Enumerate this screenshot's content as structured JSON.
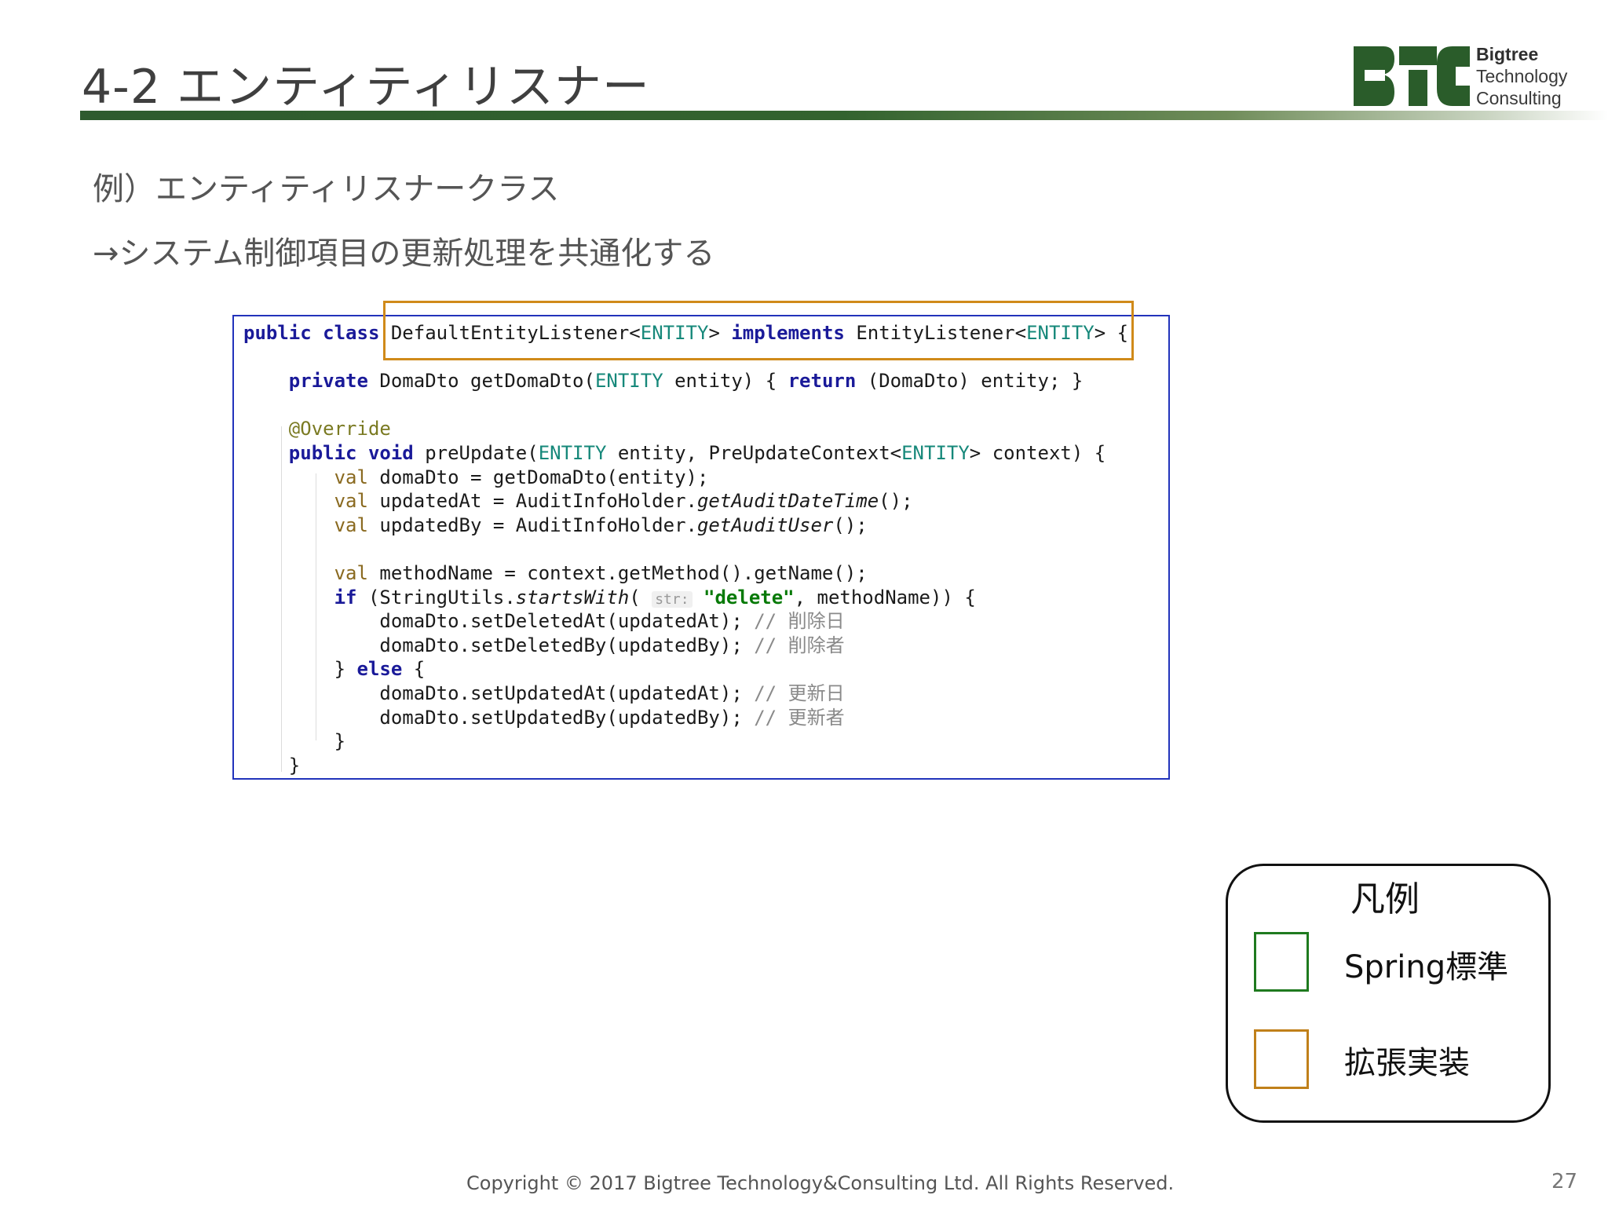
{
  "slide": {
    "title": "4-2 エンティティリスナー",
    "subtitle_1": "例）エンティティリスナークラス",
    "subtitle_2": "→システム制御項目の更新処理を共通化する",
    "footer": "Copyright © 2017 Bigtree Technology&Consulting Ltd. All Rights Reserved.",
    "page_number": "27"
  },
  "logo": {
    "line1": "Bigtree",
    "line2": "Technology",
    "line3": "Consulting",
    "colors": {
      "mark": "#2a5c2a",
      "text": "#333333"
    }
  },
  "code": {
    "class_decl": {
      "public": "public",
      "class": "class",
      "name": "DefaultEntityListener<",
      "entity_a": "ENTITY",
      "gt_a": ">",
      "implements": "implements",
      "iface": "EntityListener<",
      "entity_b": "ENTITY",
      "tail": "> {"
    },
    "getter": {
      "private": "private",
      "sig": "DomaDto getDomaDto(",
      "entity": "ENTITY",
      "param": " entity) { ",
      "return": "return",
      "body": " (DomaDto) entity; }"
    },
    "annotation": "@Override",
    "pre_update": {
      "public": "public",
      "void": "void",
      "name": "preUpdate(",
      "entity_a": "ENTITY",
      "mid": " entity, PreUpdateContext<",
      "entity_b": "ENTITY",
      "tail": "> context) {"
    },
    "val": "val",
    "line_domadto": " domaDto = getDomaDto(entity);",
    "updated_at_decl": " updatedAt = AuditInfoHolder.",
    "get_audit_date_time": "getAuditDateTime",
    "paren_semicolon": "();",
    "updated_by_decl": " updatedBy = AuditInfoHolder.",
    "get_audit_user": "getAuditUser",
    "method_name_decl": " methodName = context.getMethod().getName();",
    "if_kw": "if",
    "if_open": " (StringUtils.",
    "starts_with": "startsWith",
    "paren_open": "( ",
    "hint": "str:",
    "delete_literal": "\"delete\"",
    "if_close": ", methodName)) {",
    "set_deleted_at": "domaDto.setDeletedAt(updatedAt); ",
    "set_deleted_by": "domaDto.setDeletedBy(updatedBy); ",
    "comment_deleted_at": "// 削除日",
    "comment_deleted_by": "// 削除者",
    "else_open": "} ",
    "else_kw": "else",
    "else_brace": " {",
    "set_updated_at": "domaDto.setUpdatedAt(updatedAt); ",
    "set_updated_by": "domaDto.setUpdatedBy(updatedBy); ",
    "comment_updated_at": "// 更新日",
    "comment_updated_by": "// 更新者",
    "close_brace": "}"
  },
  "legend": {
    "title": "凡例",
    "items": [
      {
        "label": "Spring標準",
        "color": "#1f7a1f"
      },
      {
        "label": "拡張実装",
        "color": "#c0801a"
      }
    ]
  },
  "colors": {
    "title_rule": "#2e5b2f",
    "code_border": "#2233bb",
    "extension_highlight": "#d08a1a"
  }
}
